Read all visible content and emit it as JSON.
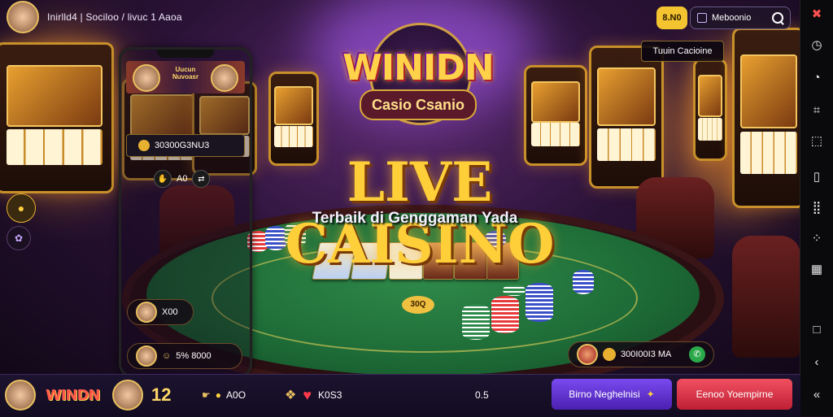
{
  "header": {
    "title": "Inirlld4 | Sociloo / livuc 1 Aaoa"
  },
  "topbar": {
    "balance_badge": "8.N0",
    "search_label": "Meboonio",
    "tooltip": "Tuuin Cacioine"
  },
  "logo": {
    "brand": "WINIDN",
    "subtitle": "Casio Csanio"
  },
  "hero": {
    "headline": "LIVE CAISINO",
    "tagline": "Terbaik di Genggaman Yada"
  },
  "phone": {
    "promo_text": "Uucun Nuvoasr",
    "code_text": "30300G3NU3",
    "stat_label": "A0"
  },
  "table_overlays": {
    "bet_chip_value": "30Q",
    "player_left_1": "X00",
    "player_left_2": "5% 8000",
    "player_right": "300I00I3 MA"
  },
  "bottombar": {
    "brand": "WINDN",
    "score": "12",
    "stat_add": "A0O",
    "stat_like": "K0S3",
    "center_value": "0.5",
    "primary_button": "Birno Neghelnisi",
    "secondary_button": "Eenoo Yoempirne"
  },
  "icons": {
    "rail": [
      "tools-icon",
      "compass-icon",
      "shield-icon",
      "crop-icon",
      "layout-icon",
      "phone-icon",
      "grid-icon",
      "qr-icon",
      "square-icon",
      "back-icon",
      "collapse-icon"
    ]
  }
}
